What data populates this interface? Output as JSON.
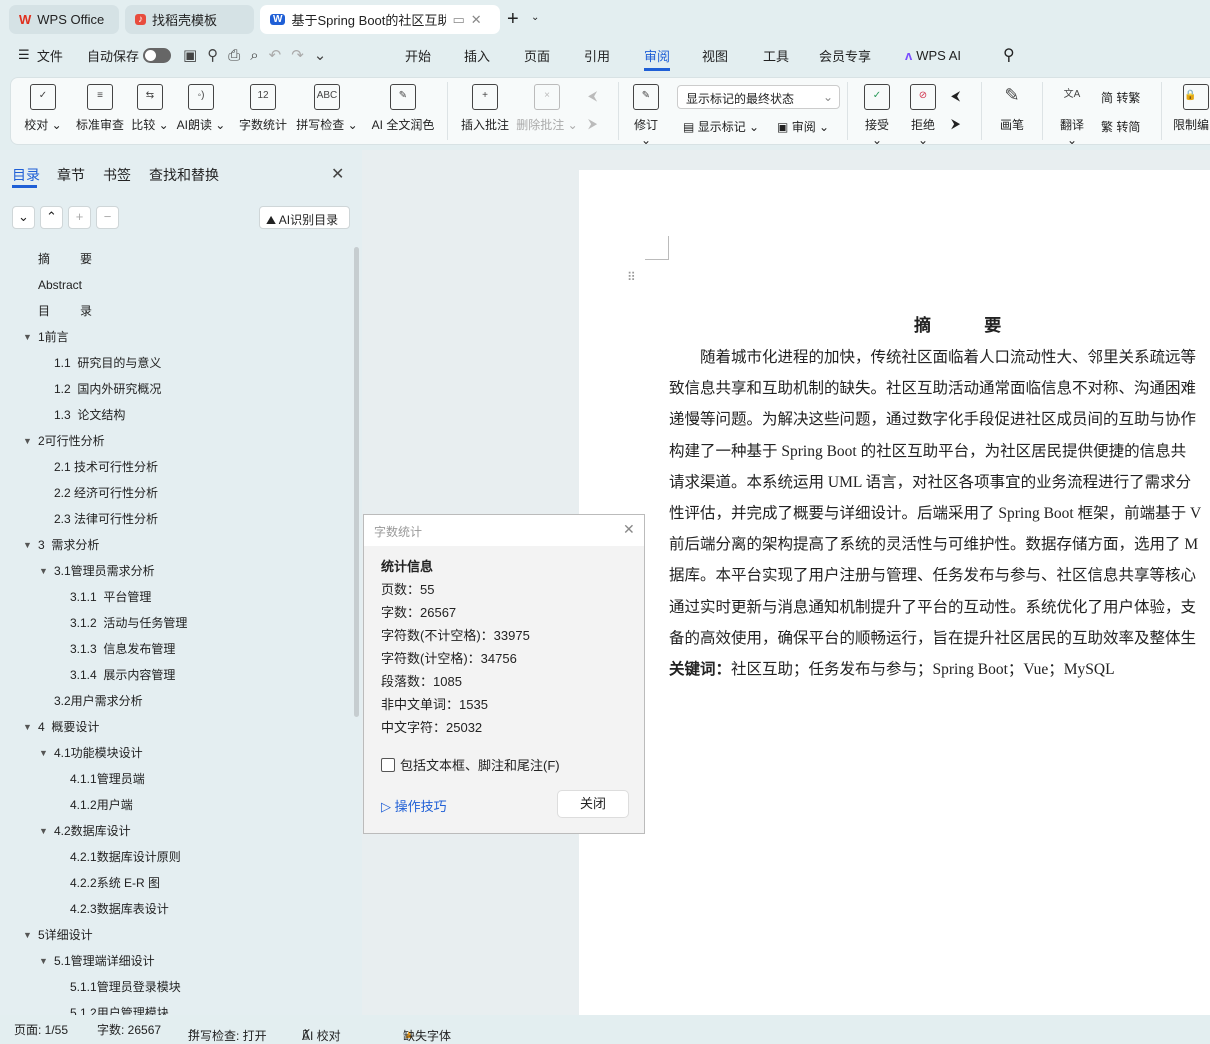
{
  "tabs": [
    {
      "label": "WPS Office",
      "icon": "wps-logo-icon",
      "color": "#e0301e"
    },
    {
      "label": "找稻壳模板",
      "icon": "docer-icon",
      "color": "#e84c3d"
    },
    {
      "label": "基于Spring Boot的社区互助平",
      "icon": "word-doc-icon",
      "color": "#1f5fd6"
    }
  ],
  "menu": {
    "file": "文件",
    "autosave": "自动保存",
    "items": [
      "开始",
      "插入",
      "页面",
      "引用",
      "审阅",
      "视图",
      "工具",
      "会员专享"
    ],
    "active": "审阅",
    "wps_ai": "WPS AI"
  },
  "ribbon": {
    "left": [
      {
        "label": "校对",
        "glyph": "✓"
      },
      {
        "label": "标准审查",
        "glyph": "≡"
      },
      {
        "label": "比较",
        "glyph": "⇆"
      },
      {
        "label": "AI朗读",
        "glyph": "◦)"
      },
      {
        "label": "字数统计",
        "glyph": "12"
      },
      {
        "label": "拼写检查",
        "glyph": "ABC"
      },
      {
        "label": "AI 全文润色",
        "glyph": "✎"
      },
      {
        "label": "插入批注",
        "glyph": "+"
      },
      {
        "label": "删除批注",
        "glyph": "×"
      }
    ],
    "track_mode": "显示标记的最终状态",
    "revise": "修订",
    "show_marks": "显示标记",
    "review": "审阅",
    "accept": "接受",
    "reject": "拒绝",
    "pen": "画笔",
    "translate": "翻译",
    "to_trad": "转繁",
    "to_simp": "转简",
    "restrict": "限制编"
  },
  "panel": {
    "tabs": [
      "目录",
      "章节",
      "书签",
      "查找和替换"
    ],
    "ai_toc": "AI识别目录",
    "toc": [
      {
        "t": "摘         要",
        "l": 0,
        "e": false
      },
      {
        "t": "Abstract",
        "l": 0,
        "e": false
      },
      {
        "t": "目         录",
        "l": 0,
        "e": false
      },
      {
        "t": "1前言",
        "l": 0,
        "e": true
      },
      {
        "t": "1.1  研究目的与意义",
        "l": 1,
        "e": false
      },
      {
        "t": "1.2  国内外研究概况",
        "l": 1,
        "e": false
      },
      {
        "t": "1.3  论文结构",
        "l": 1,
        "e": false
      },
      {
        "t": "2可行性分析",
        "l": 0,
        "e": true
      },
      {
        "t": "2.1 技术可行性分析",
        "l": 1,
        "e": false
      },
      {
        "t": "2.2 经济可行性分析",
        "l": 1,
        "e": false
      },
      {
        "t": "2.3 法律可行性分析",
        "l": 1,
        "e": false
      },
      {
        "t": "3  需求分析",
        "l": 0,
        "e": true
      },
      {
        "t": "3.1管理员需求分析",
        "l": 1,
        "e": true
      },
      {
        "t": "3.1.1  平台管理",
        "l": 2,
        "e": false
      },
      {
        "t": "3.1.2  活动与任务管理",
        "l": 2,
        "e": false
      },
      {
        "t": "3.1.3  信息发布管理",
        "l": 2,
        "e": false
      },
      {
        "t": "3.1.4  展示内容管理",
        "l": 2,
        "e": false
      },
      {
        "t": "3.2用户需求分析",
        "l": 1,
        "e": false
      },
      {
        "t": "4  概要设计",
        "l": 0,
        "e": true
      },
      {
        "t": "4.1功能模块设计",
        "l": 1,
        "e": true
      },
      {
        "t": "4.1.1管理员端",
        "l": 2,
        "e": false
      },
      {
        "t": "4.1.2用户端",
        "l": 2,
        "e": false
      },
      {
        "t": "4.2数据库设计",
        "l": 1,
        "e": true
      },
      {
        "t": "4.2.1数据库设计原则",
        "l": 2,
        "e": false
      },
      {
        "t": "4.2.2系统 E-R 图",
        "l": 2,
        "e": false
      },
      {
        "t": "4.2.3数据库表设计",
        "l": 2,
        "e": false
      },
      {
        "t": "5详细设计",
        "l": 0,
        "e": true
      },
      {
        "t": "5.1管理端详细设计",
        "l": 1,
        "e": true
      },
      {
        "t": "5.1.1管理员登录模块",
        "l": 2,
        "e": false
      },
      {
        "t": "5.1.2用户管理模块",
        "l": 2,
        "e": false
      }
    ]
  },
  "doc": {
    "title": "摘         要",
    "lines": [
      "　　随着城市化进程的加快，传统社区面临着人口流动性大、邻里关系疏远等",
      "致信息共享和互助机制的缺失。社区互助活动通常面临信息不对称、沟通困难",
      "递慢等问题。为解决这些问题，通过数字化手段促进社区成员间的互助与协作",
      "构建了一种基于 Spring Boot 的社区互助平台，为社区居民提供便捷的信息共",
      "请求渠道。本系统运用 UML 语言，对社区各项事宜的业务流程进行了需求分",
      "性评估，并完成了概要与详细设计。后端采用了 Spring Boot 框架，前端基于 V",
      "前后端分离的架构提高了系统的灵活性与可维护性。数据存储方面，选用了 M",
      "据库。本平台实现了用户注册与管理、任务发布与参与、社区信息共享等核心",
      "通过实时更新与消息通知机制提升了平台的互动性。系统优化了用户体验，支",
      "备的高效使用，确保平台的顺畅运行，旨在提升社区居民的互助效率及整体生"
    ],
    "keywords_label": "关键词：",
    "keywords": "社区互助；任务发布与参与；Spring Boot；Vue；MySQL"
  },
  "dialog": {
    "title": "字数统计",
    "heading": "统计信息",
    "stats": [
      "页数：55",
      "字数：26567",
      "字符数(不计空格)：33975",
      "字符数(计空格)：34756",
      "段落数：1085",
      "非中文单词：1535",
      "中文字符：25032"
    ],
    "checkbox": "包括文本框、脚注和尾注(F)",
    "checked": false,
    "tips": "操作技巧",
    "close": "关闭"
  },
  "status": {
    "page": "页面: 1/55",
    "words": "字数: 26567",
    "spell": "拼写检查: 打开",
    "ai": "AI 校对",
    "font": "缺失字体"
  },
  "colors": {
    "accent": "#1f5fd6",
    "warning": "#f0a020"
  }
}
